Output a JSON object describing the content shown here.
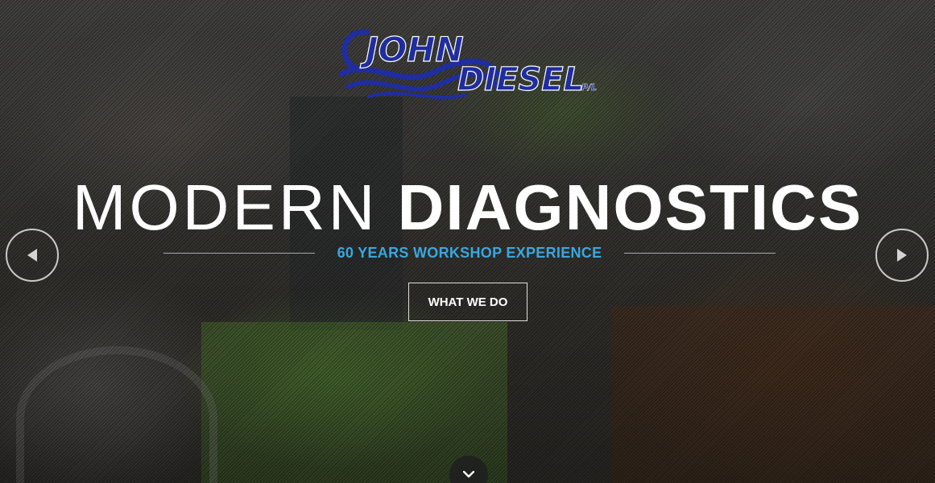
{
  "logo": {
    "word1": "JOHN",
    "word2": "DIESEL",
    "suffix": "P/L",
    "color": "#1f2d9e"
  },
  "hero": {
    "headline_light": "MODERN",
    "headline_bold": "DIAGNOSTICS",
    "subtitle": "60 YEARS WORKSHOP EXPERIENCE",
    "subtitle_color": "#3aa7df",
    "cta_label": "WHAT WE DO"
  },
  "carousel": {
    "prev_icon": "triangle-left-icon",
    "next_icon": "triangle-right-icon"
  },
  "scroll": {
    "icon": "chevron-down-icon"
  }
}
